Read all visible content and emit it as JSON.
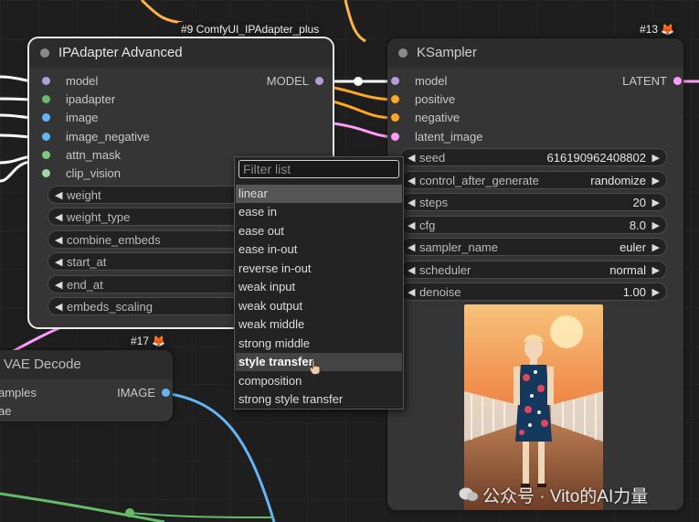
{
  "ipadapter_node": {
    "badge": "#9 ComfyUI_IPAdapter_plus",
    "title": "IPAdapter Advanced",
    "inputs": [
      "model",
      "ipadapter",
      "image",
      "image_negative",
      "attn_mask",
      "clip_vision"
    ],
    "output": "MODEL",
    "widgets": [
      "weight",
      "weight_type",
      "combine_embeds",
      "start_at",
      "end_at",
      "embeds_scaling"
    ]
  },
  "ksampler_node": {
    "badge": "#13",
    "title": "KSampler",
    "inputs": [
      "model",
      "positive",
      "negative",
      "latent_image"
    ],
    "output": "LATENT",
    "widgets": [
      {
        "label": "seed",
        "value": "616190962408802"
      },
      {
        "label": "control_after_generate",
        "value": "randomize"
      },
      {
        "label": "steps",
        "value": "20"
      },
      {
        "label": "cfg",
        "value": "8.0"
      },
      {
        "label": "sampler_name",
        "value": "euler"
      },
      {
        "label": "scheduler",
        "value": "normal"
      },
      {
        "label": "denoise",
        "value": "1.00"
      }
    ]
  },
  "vae_node": {
    "badge": "#17",
    "title": "VAE Decode",
    "inputs": [
      "amples",
      "ae"
    ],
    "output": "IMAGE"
  },
  "dropdown": {
    "placeholder": "Filter list",
    "items": [
      "linear",
      "ease in",
      "ease out",
      "ease in-out",
      "reverse in-out",
      "weak input",
      "weak output",
      "weak middle",
      "strong middle",
      "style transfer",
      "composition",
      "strong style transfer"
    ],
    "highlighted": "linear",
    "hovered": "style transfer"
  },
  "watermark": "公众号 · Vito的AI力量",
  "colors": {
    "model": "#b39ddb",
    "ipadapter": "#66bb6a",
    "image": "#64b5f6",
    "mask": "#81c784",
    "clip_vision": "#a5d6a7",
    "conditioning": "#ffa726",
    "latent": "#ff9cf9",
    "canvas": "#1e1e1e",
    "node": "#353535"
  }
}
